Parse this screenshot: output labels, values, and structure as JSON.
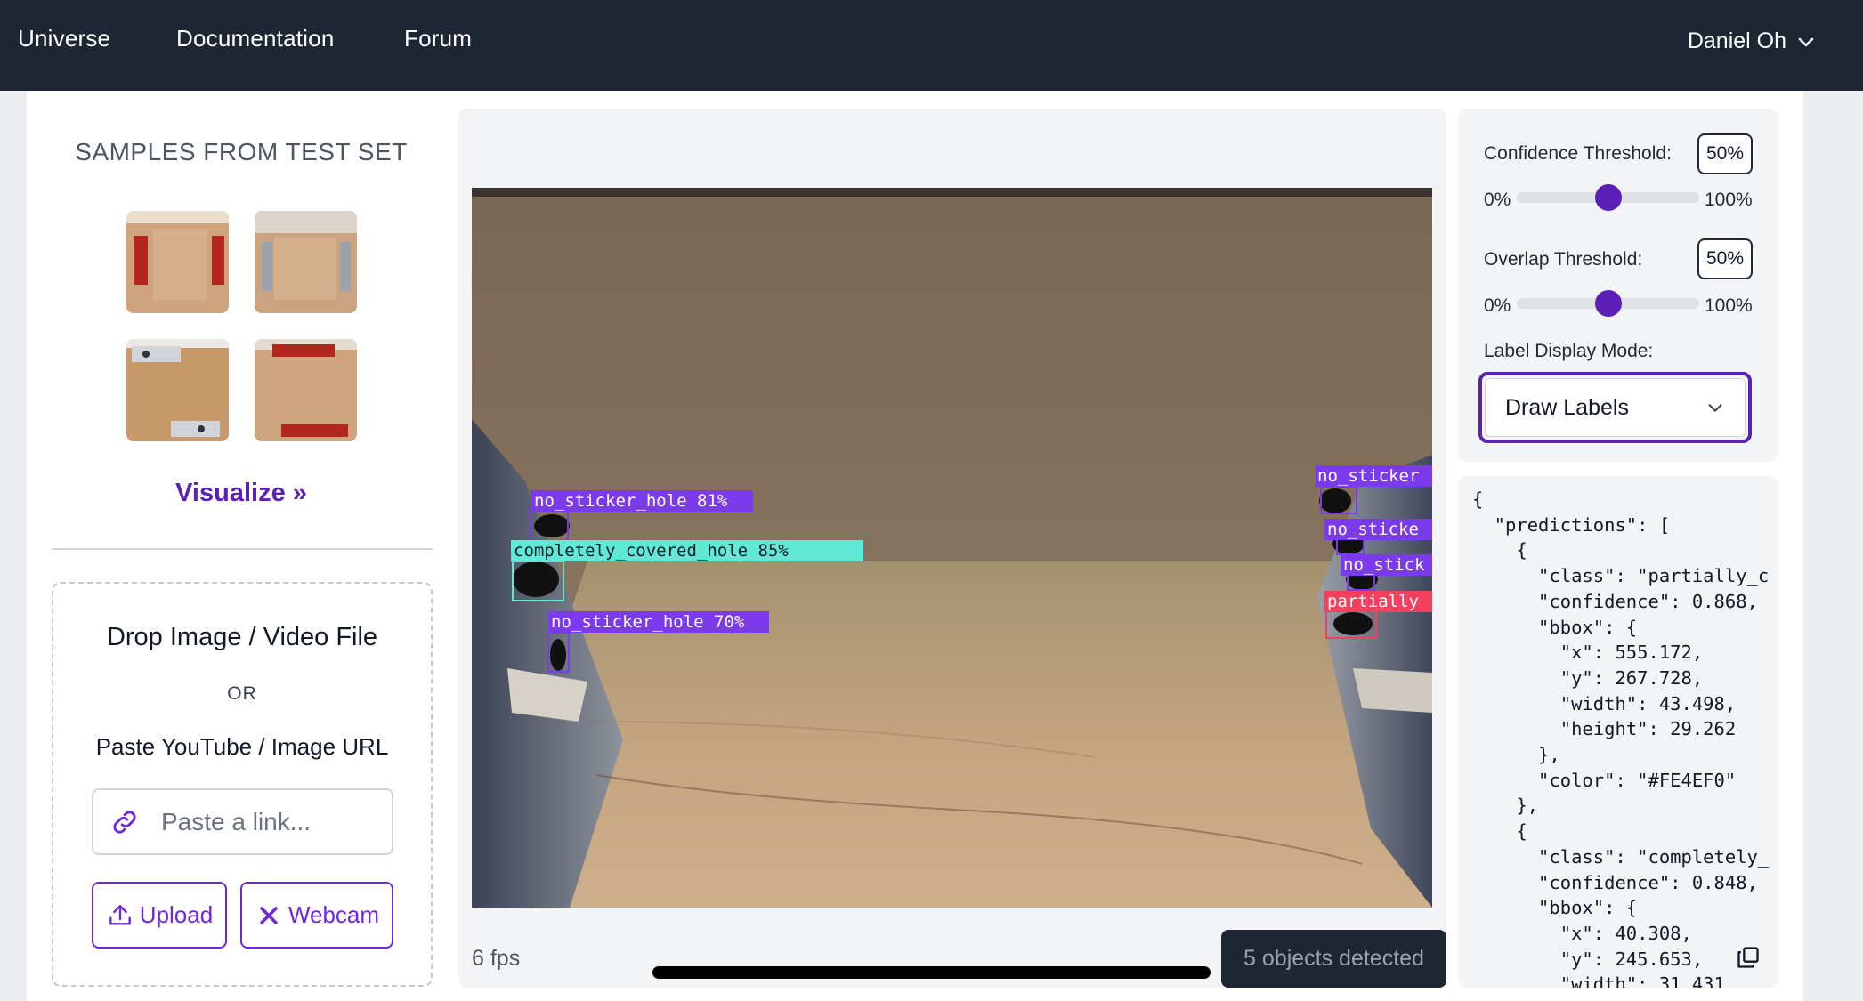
{
  "nav": {
    "links": [
      "Universe",
      "Documentation",
      "Forum"
    ],
    "user": "Daniel Oh"
  },
  "samples": {
    "title": "SAMPLES FROM TEST SET",
    "visualize": "Visualize »"
  },
  "dropzone": {
    "title": "Drop Image / Video File",
    "or": "OR",
    "paste_label": "Paste YouTube / Image URL",
    "link_placeholder": "Paste a link...",
    "upload_label": "Upload",
    "webcam_label": "Webcam"
  },
  "video": {
    "fps": "6 fps",
    "detected": "5 objects detected",
    "detections": [
      {
        "label": "no_sticker_hole 81%",
        "color": "#7c3aed"
      },
      {
        "label": "completely_covered_hole 85%",
        "color": "#5eead4"
      },
      {
        "label": "no_sticker_hole 70%",
        "color": "#7c3aed"
      },
      {
        "label": "no_sticker",
        "color": "#7c3aed"
      },
      {
        "label": "no_sticke",
        "color": "#7c3aed"
      },
      {
        "label": "no_stick",
        "color": "#7c3aed"
      },
      {
        "label": "partially",
        "color": "#f43f5e"
      }
    ]
  },
  "settings": {
    "confidence_label": "Confidence Threshold:",
    "confidence_value": "50%",
    "overlap_label": "Overlap Threshold:",
    "overlap_value": "50%",
    "range_min": "0%",
    "range_max": "100%",
    "label_mode_label": "Label Display Mode:",
    "label_mode_value": "Draw Labels",
    "accent": "#5b21b6"
  },
  "json_output": "{\n  \"predictions\": [\n    {\n      \"class\": \"partially_c\n      \"confidence\": 0.868,\n      \"bbox\": {\n        \"x\": 555.172,\n        \"y\": 267.728,\n        \"width\": 43.498,\n        \"height\": 29.262\n      },\n      \"color\": \"#FE4EF0\"\n    },\n    {\n      \"class\": \"completely_\n      \"confidence\": 0.848,\n      \"bbox\": {\n        \"x\": 40.308,\n        \"y\": 245.653,\n        \"width\": 31.431"
}
